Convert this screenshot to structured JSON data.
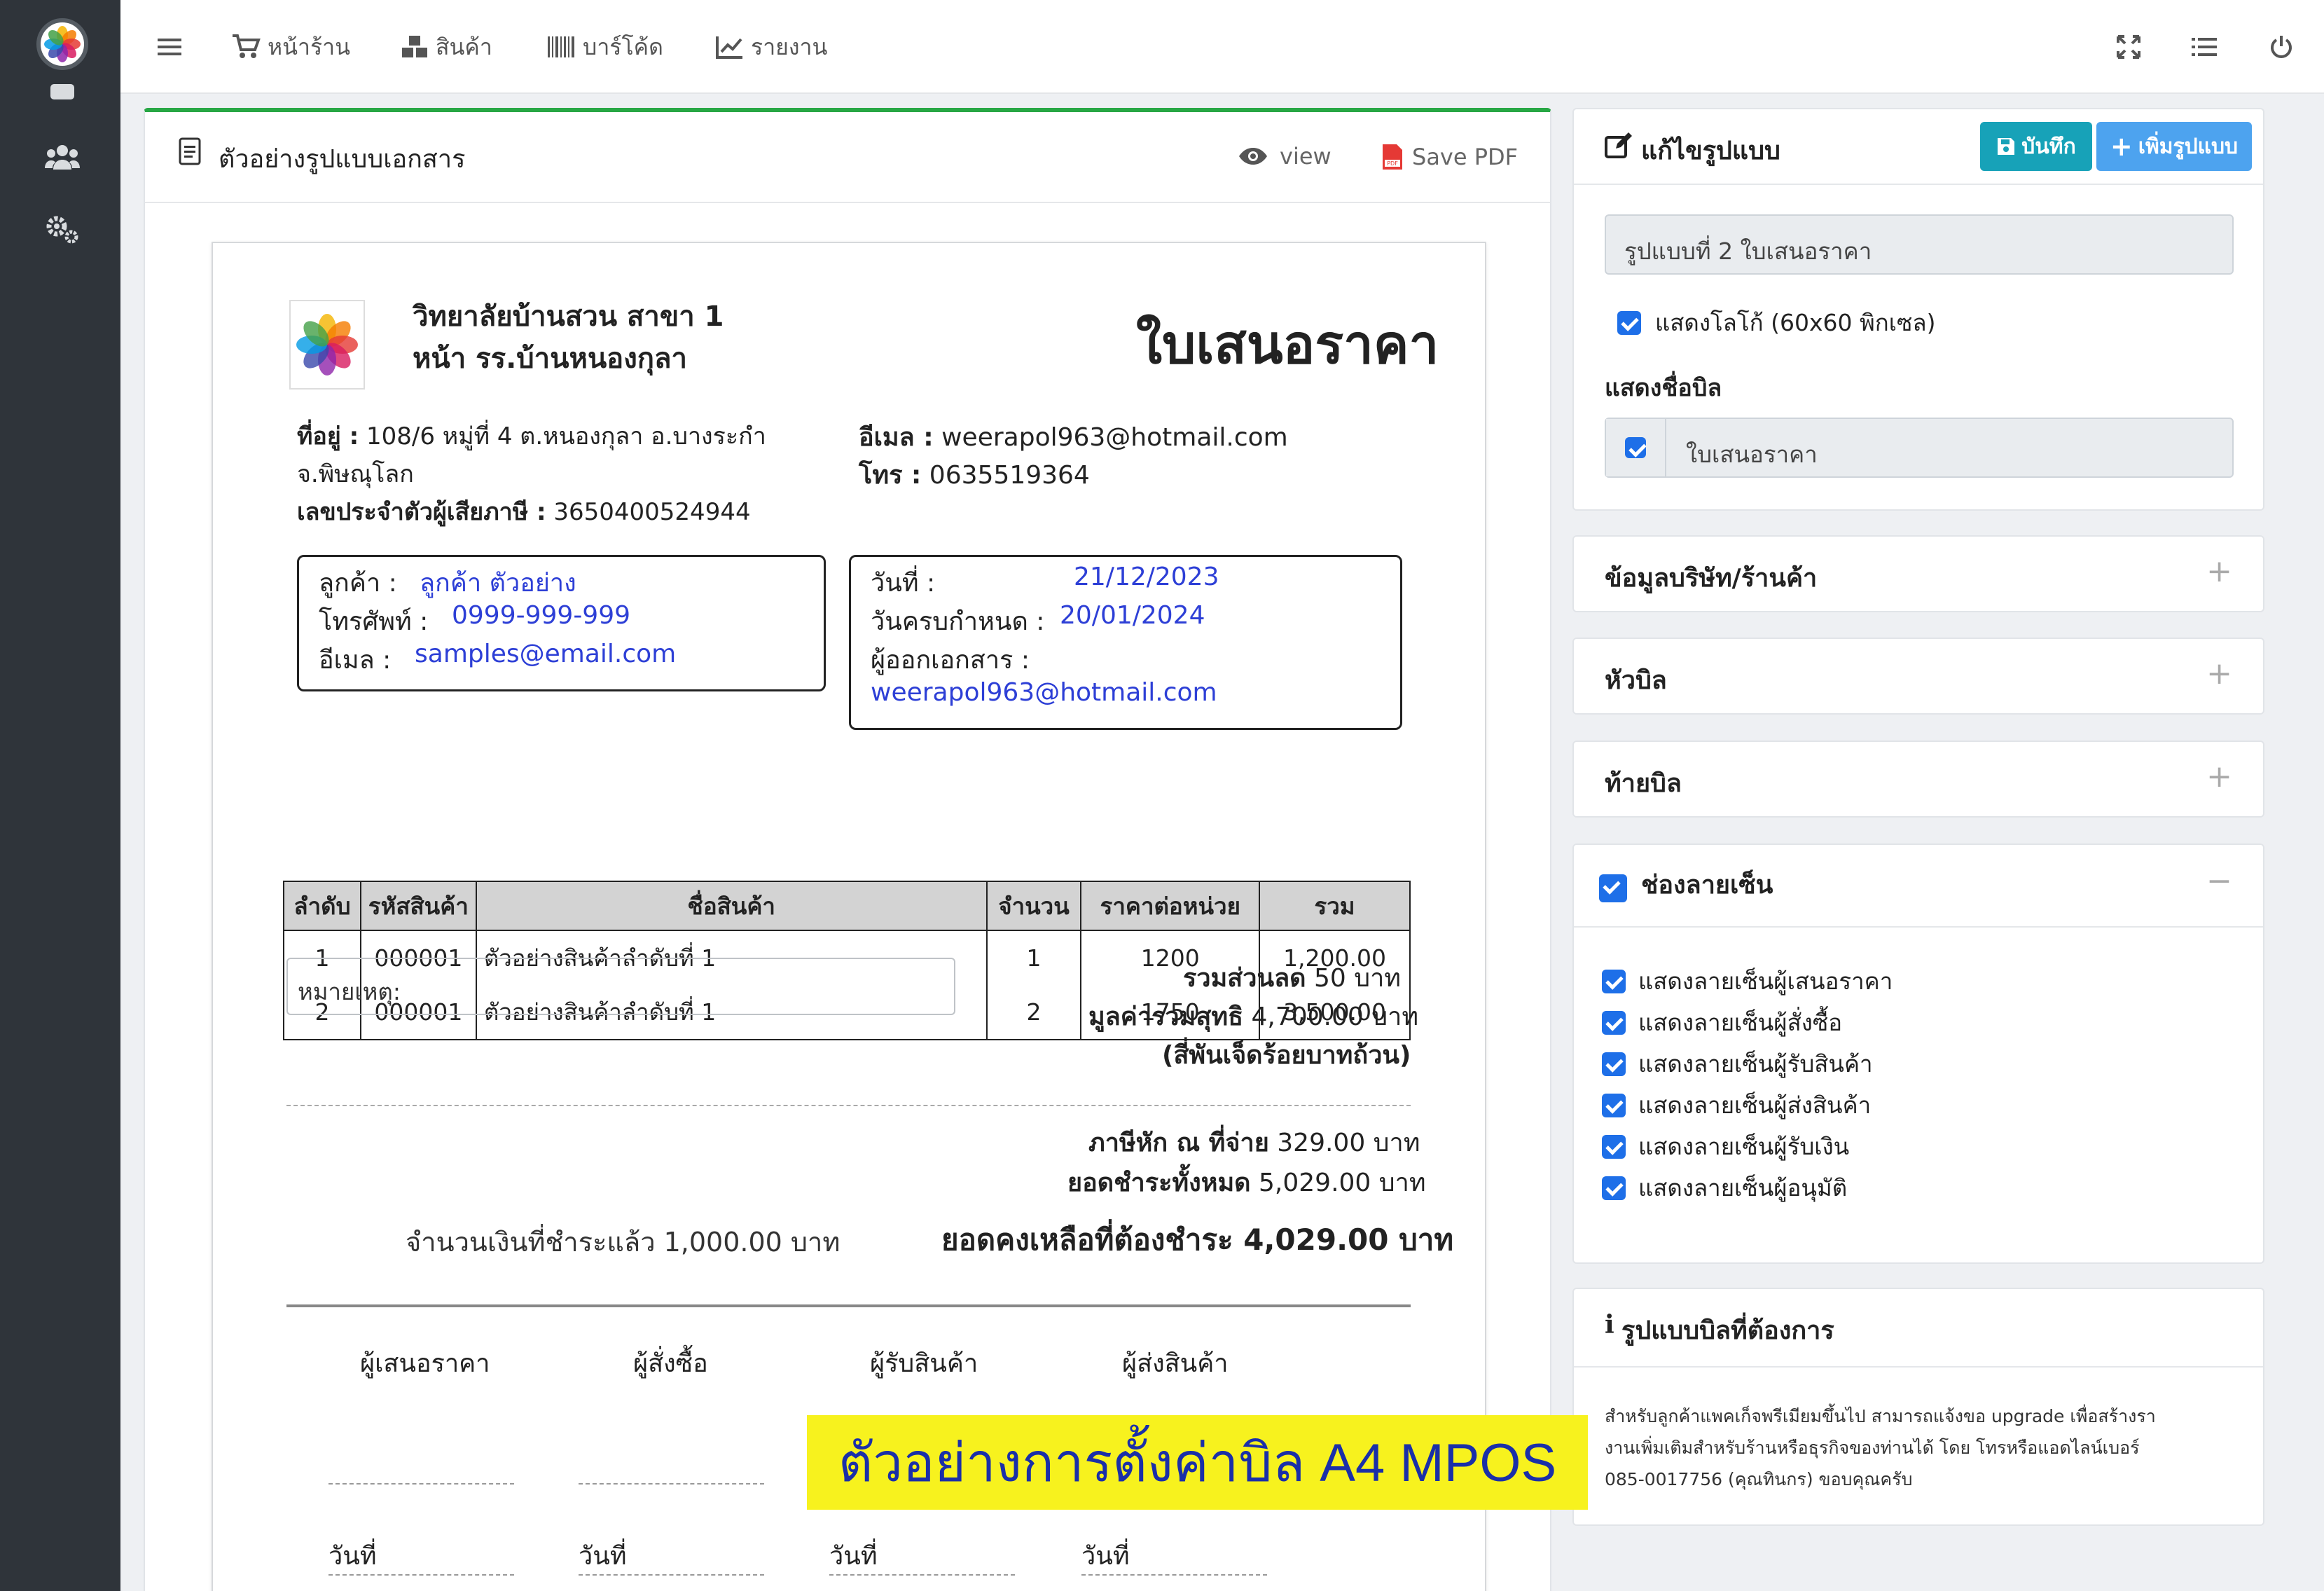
{
  "topnav": {
    "items": [
      "หน้าร้าน",
      "สินค้า",
      "บาร์โค้ด",
      "รายงาน"
    ]
  },
  "doc_panel": {
    "title": "ตัวอย่างรูปแบบเอกสาร",
    "view_label": "view",
    "pdf_label": "Save PDF"
  },
  "document": {
    "company_line1": "วิทยาลัยบ้านสวน สาขา 1",
    "company_line2": "หน้า รร.บ้านหนองกุลา",
    "doc_title": "ใบเสนอราคา",
    "address_label": "ที่อยู่ :",
    "address_line1": "108/6 หมู่ที่ 4 ต.หนองกุลา อ.บางระกำ",
    "address_line2": "จ.พิษณุโลก",
    "tax_label": "เลขประจำตัวผู้เสียภาษี :",
    "tax_id": "3650400524944",
    "email_label": "อีเมล :",
    "email": "weerapol963@hotmail.com",
    "phone_label": "โทร :",
    "phone": "0635519364",
    "customer_label": "ลูกค้า :",
    "customer": "ลูกค้า ตัวอย่าง",
    "cust_phone_label": "โทรศัพท์ :",
    "cust_phone": "0999-999-999",
    "cust_email_label": "อีเมล :",
    "cust_email": "samples@email.com",
    "date_label": "วันที่ :",
    "date": "21/12/2023",
    "due_label": "วันครบกำหนด :",
    "due_date": "20/01/2024",
    "issuer_label": "ผู้ออกเอกสาร :",
    "issuer": "weerapol963@hotmail.com",
    "table_headers": [
      "ลำดับ",
      "รหัสสินค้า",
      "ชื่อสินค้า",
      "จำนวน",
      "ราคาต่อหน่วย",
      "รวม"
    ],
    "rows": [
      [
        "1",
        "000001",
        "ตัวอย่างสินค้าลำดับที่ 1",
        "1",
        "1200",
        "1,200.00"
      ],
      [
        "2",
        "000001",
        "ตัวอย่างสินค้าลำดับที่ 1",
        "2",
        "1750",
        "3,500.00"
      ]
    ],
    "note_label": "หมายเหตุ:",
    "discount_label": "รวมส่วนลด",
    "discount_value": "50 บาท",
    "net_label": "มูลค่ารวมสุทธิ",
    "net_value": "4,700.00 บาท",
    "net_words": "(สี่พันเจ็ดร้อยบาทถ้วน)",
    "wht_label": "ภาษีหัก ณ ที่จ่าย",
    "wht_value": "329.00 บาท",
    "total_label": "ยอดชำระทั้งหมด",
    "total_value": "5,029.00 บาท",
    "paid_text": "จำนวนเงินที่ชำระแล้ว 1,000.00 บาท",
    "balance_text": "ยอดคงเหลือที่ต้องชำระ 4,029.00 บาท",
    "signatures": [
      "ผู้เสนอราคา",
      "ผู้สั่งซื้อ",
      "ผู้รับสินค้า",
      "ผู้ส่งสินค้า"
    ],
    "sig_date_label": "วันที่"
  },
  "editor": {
    "title": "แก้ไขรูปแบบ",
    "save_btn": "บันทึก",
    "add_btn": "เพิ่มรูปแบบ",
    "template_name": "รูปแบบที่ 2 ใบเสนอราคา",
    "show_logo_label": "แสดงโลโก้ (60x60 พิกเซล)",
    "bill_name_heading": "แสดงชื่อบิล",
    "bill_name_value": "ใบเสนอราคา"
  },
  "sections": {
    "company": "ข้อมูลบริษัท/ร้านค้า",
    "header": "หัวบิล",
    "footer": "ท้ายบิล",
    "signature": "ช่องลายเซ็น",
    "plus": "+",
    "minus": "−"
  },
  "signature_options": [
    "แสดงลายเซ็นผู้เสนอราคา",
    "แสดงลายเซ็นผู้สั่งซื้อ",
    "แสดงลายเซ็นผู้รับสินค้า",
    "แสดงลายเซ็นผู้ส่งสินค้า",
    "แสดงลายเซ็นผู้รับเงิน",
    "แสดงลายเซ็นผู้อนุมัติ"
  ],
  "info": {
    "icon_glyph": "i",
    "title": "รูปแบบบิลที่ต้องการ",
    "line1": "สำหรับลูกค้าแพคเก็จพรีเมียมขึ้นไป สามารถแจ้งขอ upgrade เพื่อสร้างรา",
    "line2": "งานเพิ่มเติมสำหรับร้านหรือธุรกิจของท่านได้ โดย โทรหรือแอดไลน์เบอร์",
    "line3": "085-0017756 (คุณทินกร) ขอบคุณครับ"
  },
  "banner": "ตัวอย่างการตั้งค่าบิล A4 MPOS",
  "colors": {
    "sidebar": "#2f343a",
    "accent_green": "#28a745",
    "save_btn": "#17a2b8",
    "add_btn": "#4da3ef",
    "checkbox": "#1e6fe8",
    "banner_bg": "#f7f21e",
    "banner_text": "#1a2fa8"
  }
}
